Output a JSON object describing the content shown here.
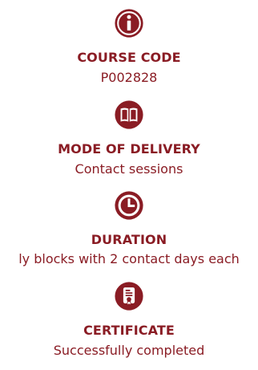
{
  "colors": {
    "accent": "#8a1c24"
  },
  "items": [
    {
      "icon": "info-icon",
      "label": "COURSE CODE",
      "value": "P002828"
    },
    {
      "icon": "book-icon",
      "label": "MODE OF DELIVERY",
      "value": "Contact sessions"
    },
    {
      "icon": "clock-icon",
      "label": "DURATION",
      "value": "ly blocks with 2 contact days each"
    },
    {
      "icon": "certificate-icon",
      "label": "CERTIFICATE",
      "value": "Successfully completed"
    }
  ]
}
